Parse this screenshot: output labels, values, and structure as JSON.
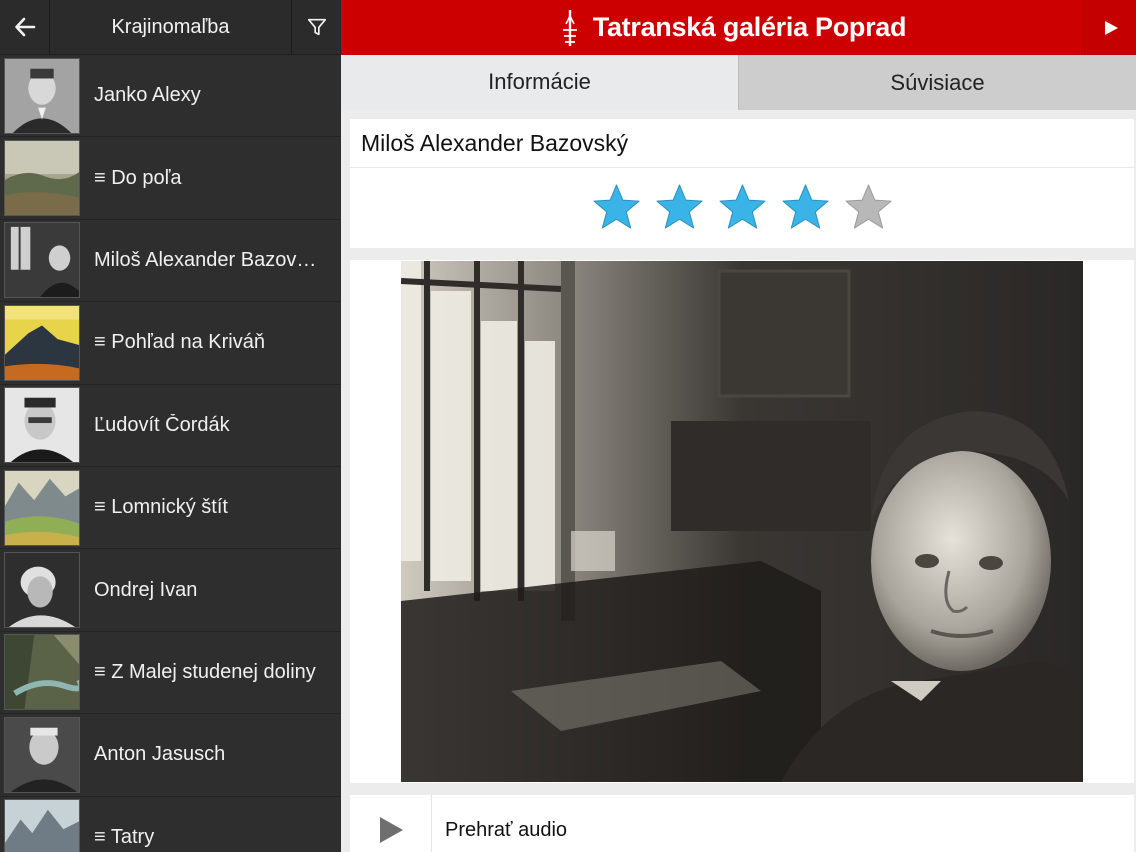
{
  "sidebar": {
    "title": "Krajinomaľba",
    "back_icon": "arrow-left-icon",
    "filter_icon": "filter-icon",
    "items": [
      {
        "label": "Janko Alexy",
        "type": "artist"
      },
      {
        "label": "≡ Do poľa",
        "type": "artwork"
      },
      {
        "label": "Miloš Alexander Bazovský",
        "type": "artist"
      },
      {
        "label": "≡ Pohľad na Kriváň",
        "type": "artwork"
      },
      {
        "label": "Ľudovít Čordák",
        "type": "artist"
      },
      {
        "label": "≡ Lomnický štít",
        "type": "artwork"
      },
      {
        "label": "Ondrej Ivan",
        "type": "artist"
      },
      {
        "label": "≡ Z Malej studenej doliny",
        "type": "artwork"
      },
      {
        "label": "Anton Jasusch",
        "type": "artist"
      },
      {
        "label": "≡ Tatry",
        "type": "artwork"
      }
    ]
  },
  "header": {
    "brand_title": "Tatranská galéria Poprad",
    "brand_color": "#cc0000",
    "play_icon": "play-icon"
  },
  "tabs": [
    {
      "label": "Informácie",
      "active": true
    },
    {
      "label": "Súvisiace",
      "active": false
    }
  ],
  "detail": {
    "artist_name": "Miloš Alexander Bazovský",
    "rating": 4,
    "rating_max": 5,
    "star_color_on": "#3ab4e6",
    "star_color_off": "#b8b8b8"
  },
  "audio": {
    "label": "Prehrať audio",
    "icon": "play-icon"
  }
}
